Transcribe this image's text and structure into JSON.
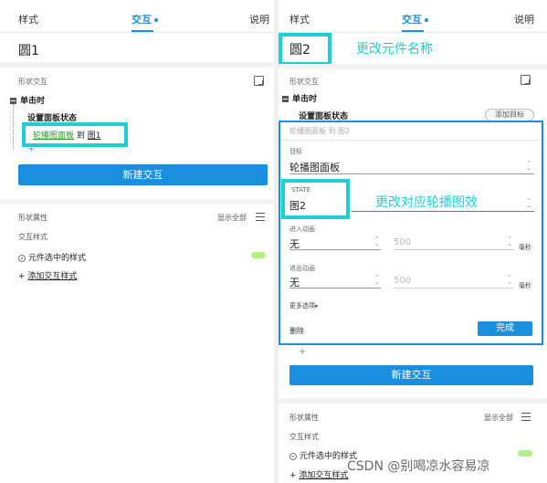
{
  "left": {
    "tabs": [
      "样式",
      "交互",
      "说明"
    ],
    "name": "圆1",
    "section_label": "形状交互",
    "event": "单击时",
    "action": "设置面板状态",
    "target_link": "轮播图面板",
    "target_to": "到",
    "target_state": "图1",
    "plus": "+",
    "new_interaction": "新建交互",
    "props_label": "形状属性",
    "show_all": "显示全部",
    "interaction_styles": "交互样式",
    "selected_style": "元件选中的样式",
    "add_style": "添加交互样式"
  },
  "right": {
    "tabs": [
      "样式",
      "交互",
      "说明"
    ],
    "name": "圆2",
    "annotation_name": "更改元件名称",
    "section_label": "形状交互",
    "event": "单击时",
    "action": "设置面板状态",
    "add_target": "添加目标",
    "editor_header": "轮播图面板 到 图2",
    "target_label": "目标",
    "target_value": "轮播图面板",
    "state_label": "STATE",
    "state_value": "图2",
    "annotation_state": "更改对应轮播图效",
    "enter_anim_label": "进入动画",
    "enter_anim_value": "无",
    "enter_duration": "500",
    "exit_anim_label": "退出动画",
    "exit_anim_value": "无",
    "exit_duration": "500",
    "unit": "毫秒",
    "more_options": "更多选项▸",
    "delete": "删除",
    "done": "完成",
    "plus": "+",
    "new_interaction": "新建交互",
    "props_label": "形状属性",
    "show_all": "显示全部",
    "interaction_styles": "交互样式",
    "selected_style": "元件选中的样式",
    "add_style": "添加交互样式"
  },
  "watermark": "CSDN @别喝凉水容易凉",
  "colors": {
    "accent": "#1a8fe0",
    "annotation": "#1ecfd6",
    "swatch": "#b5ef8a",
    "link_green": "#2b9a2b"
  }
}
